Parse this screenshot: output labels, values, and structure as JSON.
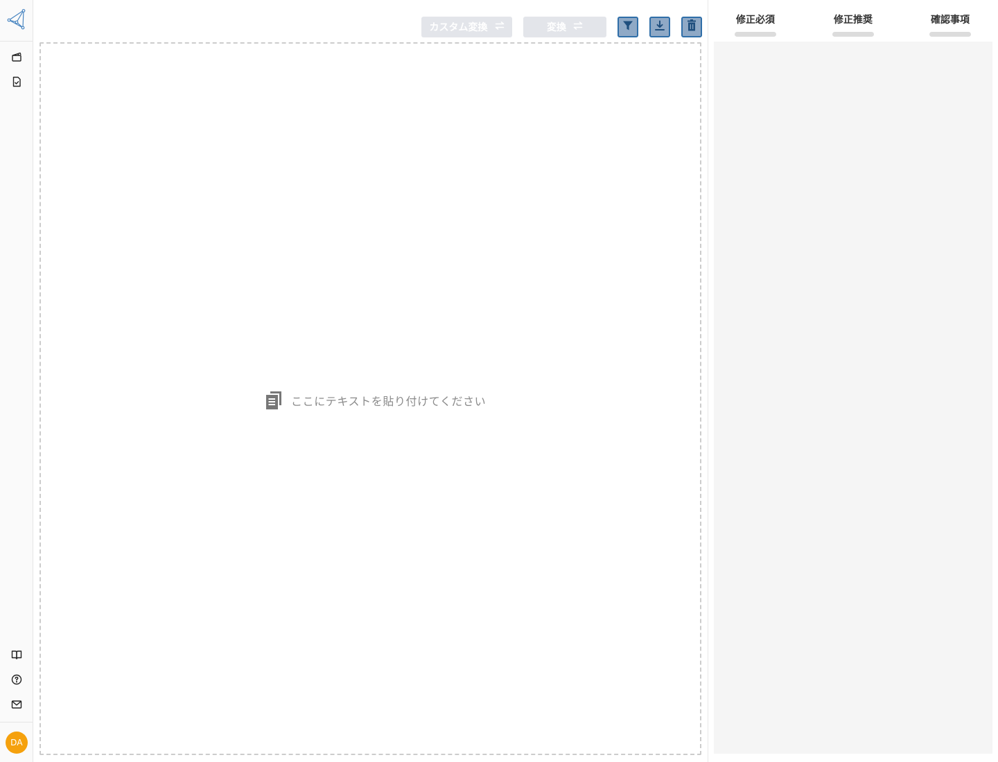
{
  "sidebar": {
    "logo_icon": "triangle-network-logo-icon",
    "nav_items": [
      {
        "icon": "clapperboard-icon"
      },
      {
        "icon": "document-check-icon"
      }
    ],
    "bottom_items": [
      {
        "icon": "book-open-icon"
      },
      {
        "icon": "help-circle-icon"
      },
      {
        "icon": "mail-icon"
      }
    ],
    "avatar": {
      "initials": "DA",
      "color": "#f5a10d"
    }
  },
  "toolbar": {
    "custom_convert_label": "カスタム変換",
    "convert_label": "変換",
    "swap_icon": "swap-arrows-icon",
    "filter_icon": "filter-icon",
    "download_icon": "download-icon",
    "delete_icon": "trash-icon",
    "accent_color": "#2f6ea8"
  },
  "editor": {
    "placeholder": "ここにテキストを貼り付けてください",
    "placeholder_icon": "copy-document-icon"
  },
  "right_panel": {
    "tabs": [
      {
        "label": "修正必須"
      },
      {
        "label": "修正推奨"
      },
      {
        "label": "確認事項"
      }
    ]
  }
}
